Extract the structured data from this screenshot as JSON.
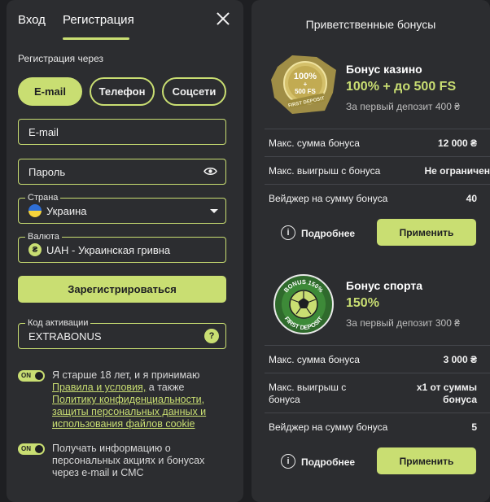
{
  "left": {
    "tabs": [
      "Вход",
      "Регистрация"
    ],
    "register_via_label": "Регистрация через",
    "methods": [
      "E-mail",
      "Телефон",
      "Соцсети"
    ],
    "email_placeholder": "E-mail",
    "password_placeholder": "Пароль",
    "country": {
      "legend": "Страна",
      "value": "Украина"
    },
    "currency": {
      "legend": "Валюта",
      "value": "UAH - Украинская гривна",
      "symbol": "₴"
    },
    "submit_label": "Зарегистрироваться",
    "promo": {
      "legend": "Код активации",
      "value": "EXTRABONUS",
      "help": "?"
    },
    "consent1": {
      "toggle": "ON",
      "text_before": "Я старше 18 лет, и я принимаю",
      "terms_link": "Правила и условия,",
      "text_mid": " а также",
      "privacy_link": "Политику конфиденциальности, защиты персональных данных и использования файлов cookie"
    },
    "consent2": {
      "toggle": "ON",
      "text": "Получать информацию о персональных акциях и бонусах через e-mail и СМС"
    }
  },
  "right": {
    "title": "Приветственные бонусы",
    "casino": {
      "badge_big": "100%",
      "badge_plus": "+",
      "badge_small": "500 FS",
      "badge_ribbon": "FIRST DEPOSIT",
      "name": "Бонус казино",
      "amount": "100% + до 500 FS",
      "sub": "За первый депозит 400 ₴",
      "rows": [
        {
          "k": "Макс. сумма бонуса",
          "v": "12 000 ₴"
        },
        {
          "k": "Макс. выигрыш с бонуса",
          "v": "Не ограничен"
        },
        {
          "k": "Вейджер на сумму бонуса",
          "v": "40"
        }
      ],
      "more": "Подробнее",
      "apply": "Применить"
    },
    "sport": {
      "badge_top": "BONUS 150%",
      "badge_bottom": "FIRST DEPOSIT",
      "name": "Бонус спорта",
      "amount": "150%",
      "sub": "За первый депозит 300 ₴",
      "rows": [
        {
          "k": "Макс. сумма бонуса",
          "v": "3 000 ₴"
        },
        {
          "k1": "Макс. выигрыш с",
          "k2": "бонуса",
          "v1": "x1 от суммы",
          "v2": "бонуса"
        },
        {
          "k": "Вейджер на сумму бонуса",
          "v": "5"
        }
      ],
      "more": "Подробнее",
      "apply": "Применить"
    },
    "info_glyph": "i"
  },
  "colors": {
    "accent": "#c9de72",
    "panel": "#2c2d30",
    "background": "#1e1f22"
  },
  "icons": [
    "close-icon",
    "eye-icon",
    "ukraine-flag-icon",
    "hryvnia-icon",
    "question-icon",
    "info-icon"
  ]
}
